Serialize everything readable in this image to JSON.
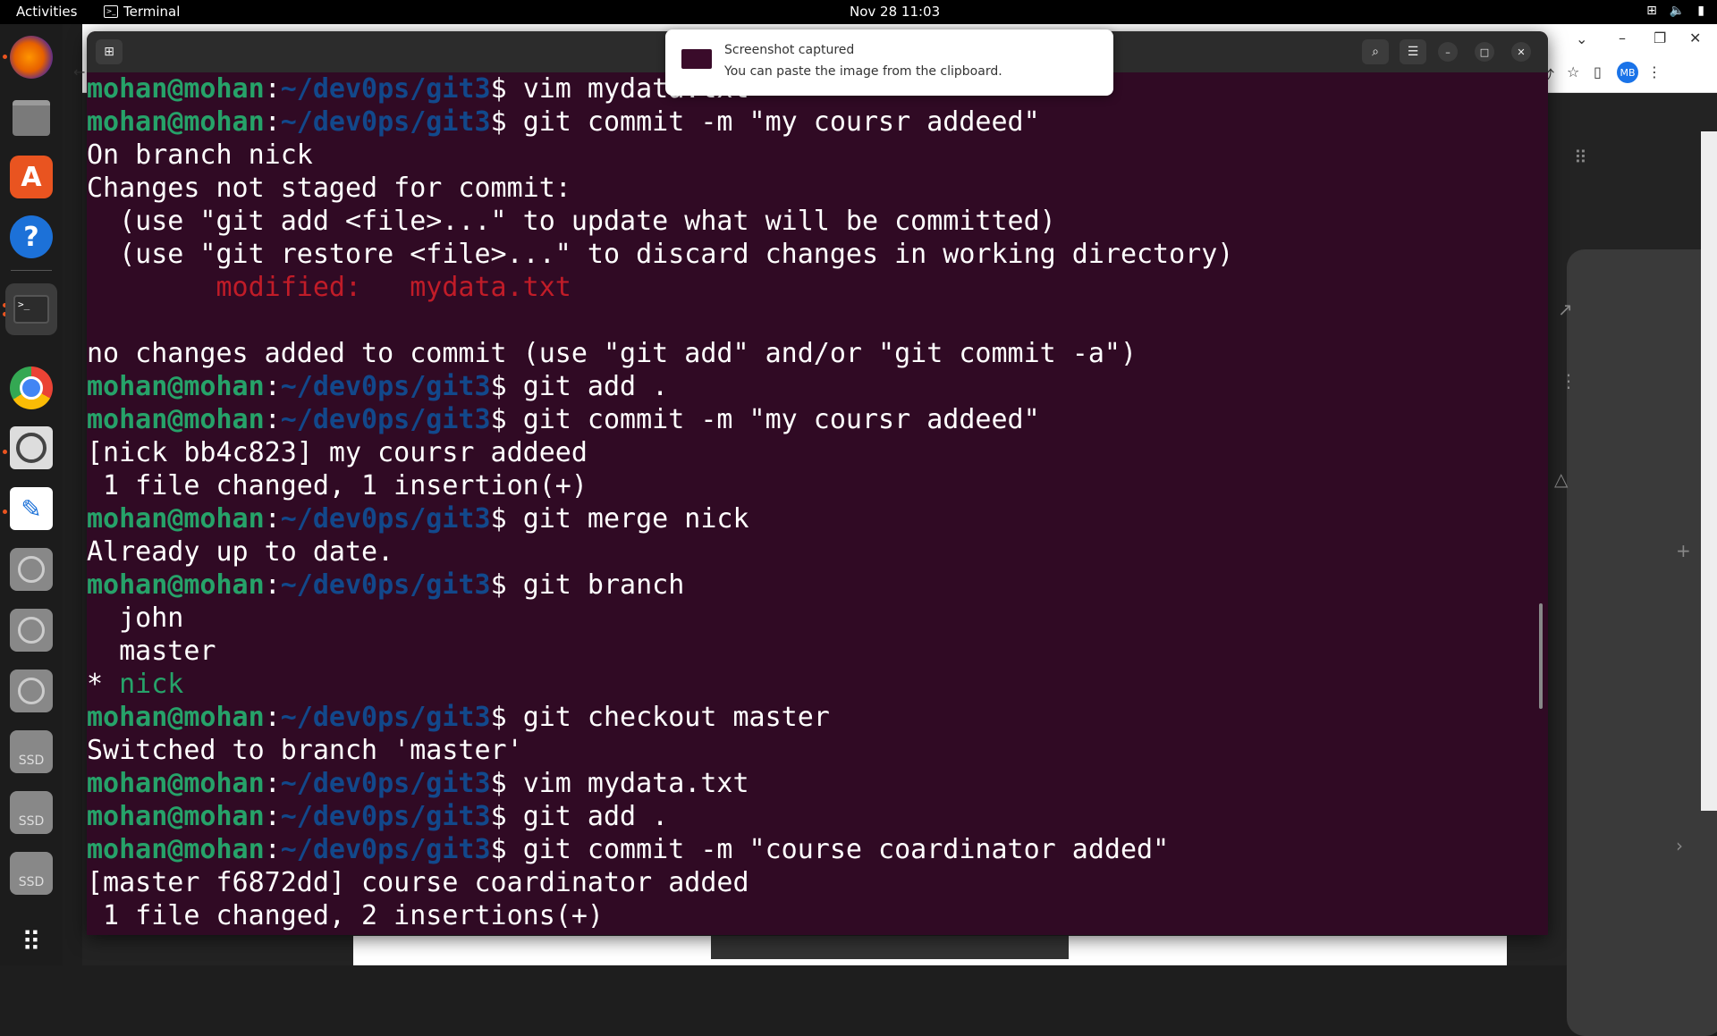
{
  "topbar": {
    "activities": "Activities",
    "app_name": "Terminal",
    "clock": "Nov 28  11:03"
  },
  "notification": {
    "title": "Screenshot captured",
    "body": "You can paste the image from the clipboard."
  },
  "browser_bg": {
    "avatar": "MB"
  },
  "dock": {
    "items": [
      "firefox-icon",
      "files-icon",
      "app-center-icon",
      "help-icon",
      "terminal-icon",
      "chrome-icon",
      "screenshot-icon",
      "text-editor-icon",
      "disc-icon",
      "disc-icon",
      "disc-icon",
      "ssd-icon",
      "ssd-icon",
      "ssd-icon",
      "show-apps-icon"
    ],
    "ssd_label": "SSD"
  },
  "terminal": {
    "user": "mohan@mohan",
    "sep": ":",
    "path": "~/dev0ps/git3",
    "dollar": "$ ",
    "lines": [
      {
        "type": "prompt",
        "cmd": "vim mydata.txt"
      },
      {
        "type": "prompt",
        "cmd": "git commit -m \"my coursr addeed\""
      },
      {
        "type": "out",
        "text": "On branch nick"
      },
      {
        "type": "out",
        "text": "Changes not staged for commit:"
      },
      {
        "type": "out",
        "text": "  (use \"git add <file>...\" to update what will be committed)"
      },
      {
        "type": "out",
        "text": "  (use \"git restore <file>...\" to discard changes in working directory)"
      },
      {
        "type": "mod",
        "text": "        modified:   mydata.txt"
      },
      {
        "type": "out",
        "text": ""
      },
      {
        "type": "out",
        "text": "no changes added to commit (use \"git add\" and/or \"git commit -a\")"
      },
      {
        "type": "prompt",
        "cmd": "git add ."
      },
      {
        "type": "prompt",
        "cmd": "git commit -m \"my coursr addeed\""
      },
      {
        "type": "out",
        "text": "[nick bb4c823] my coursr addeed"
      },
      {
        "type": "out",
        "text": " 1 file changed, 1 insertion(+)"
      },
      {
        "type": "prompt",
        "cmd": "git merge nick"
      },
      {
        "type": "out",
        "text": "Already up to date."
      },
      {
        "type": "prompt",
        "cmd": "git branch"
      },
      {
        "type": "out",
        "text": "  john"
      },
      {
        "type": "out",
        "text": "  master"
      },
      {
        "type": "cur",
        "star": "* ",
        "text": "nick"
      },
      {
        "type": "prompt",
        "cmd": "git checkout master"
      },
      {
        "type": "out",
        "text": "Switched to branch 'master'"
      },
      {
        "type": "prompt",
        "cmd": "vim mydata.txt"
      },
      {
        "type": "prompt",
        "cmd": "git add ."
      },
      {
        "type": "prompt",
        "cmd": "git commit -m \"course coardinator added\""
      },
      {
        "type": "out",
        "text": "[master f6872dd] course coardinator added"
      },
      {
        "type": "out",
        "text": " 1 file changed, 2 insertions(+)"
      }
    ]
  }
}
